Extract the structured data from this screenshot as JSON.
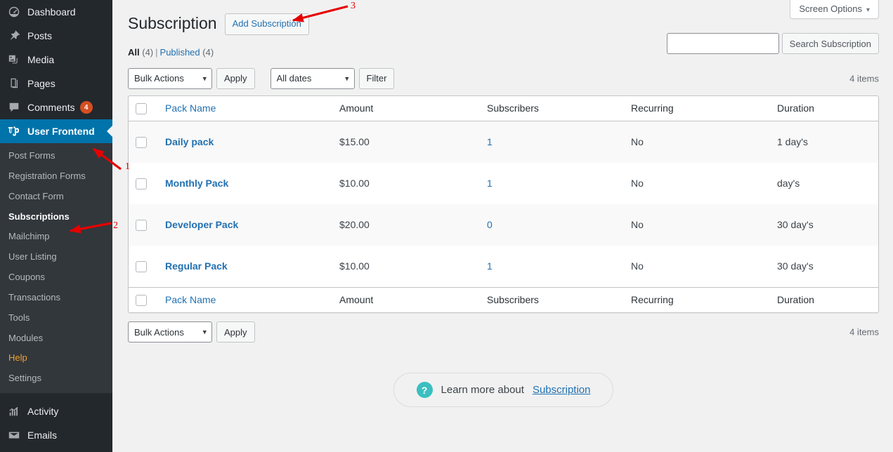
{
  "sidebar": {
    "top_items": [
      {
        "label": "Dashboard",
        "icon": "dashboard-icon",
        "badge": null,
        "current": false
      },
      {
        "label": "Posts",
        "icon": "pin-icon",
        "badge": null,
        "current": false
      },
      {
        "label": "Media",
        "icon": "media-icon",
        "badge": null,
        "current": false
      },
      {
        "label": "Pages",
        "icon": "pages-icon",
        "badge": null,
        "current": false
      },
      {
        "label": "Comments",
        "icon": "comment-icon",
        "badge": "4",
        "current": false
      },
      {
        "label": "User Frontend",
        "icon": "wpuf-logo-icon",
        "badge": null,
        "current": true
      }
    ],
    "submenu": [
      {
        "label": "Post Forms",
        "state": "normal"
      },
      {
        "label": "Registration Forms",
        "state": "normal"
      },
      {
        "label": "Contact Form",
        "state": "normal"
      },
      {
        "label": "Subscriptions",
        "state": "current"
      },
      {
        "label": "Mailchimp",
        "state": "normal"
      },
      {
        "label": "User Listing",
        "state": "normal"
      },
      {
        "label": "Coupons",
        "state": "normal"
      },
      {
        "label": "Transactions",
        "state": "normal"
      },
      {
        "label": "Tools",
        "state": "normal"
      },
      {
        "label": "Modules",
        "state": "normal"
      },
      {
        "label": "Help",
        "state": "help"
      },
      {
        "label": "Settings",
        "state": "normal"
      }
    ],
    "bottom_items": [
      {
        "label": "Activity",
        "icon": "activity-icon"
      },
      {
        "label": "Emails",
        "icon": "envelope-icon"
      }
    ]
  },
  "screen_meta": {
    "screen_options_label": "Screen Options",
    "caret": "▾"
  },
  "header": {
    "title": "Subscription",
    "add_button_label": "Add Subscription"
  },
  "search": {
    "value": "",
    "placeholder": "",
    "submit_label": "Search Subscription"
  },
  "views": {
    "all_label": "All",
    "all_count": "(4)",
    "divider": "|",
    "published_label": "Published",
    "published_count": "(4)"
  },
  "tablenav_top": {
    "bulk_actions_value": "Bulk Actions",
    "bulk_actions_options": [
      "Bulk Actions"
    ],
    "apply_label": "Apply",
    "dates_value": "All dates",
    "dates_options": [
      "All dates"
    ],
    "filter_label": "Filter",
    "items_count": "4 items"
  },
  "tablenav_bottom": {
    "bulk_actions_value": "Bulk Actions",
    "bulk_actions_options": [
      "Bulk Actions"
    ],
    "apply_label": "Apply",
    "items_count": "4 items"
  },
  "table": {
    "columns": [
      "Pack Name",
      "Amount",
      "Subscribers",
      "Recurring",
      "Duration"
    ],
    "rows": [
      {
        "name": "Daily pack",
        "amount": "$15.00",
        "subscribers": "1",
        "recurring": "No",
        "duration": "1 day's"
      },
      {
        "name": "Monthly Pack",
        "amount": "$10.00",
        "subscribers": "1",
        "recurring": "No",
        "duration": "day's"
      },
      {
        "name": "Developer Pack",
        "amount": "$20.00",
        "subscribers": "0",
        "recurring": "No",
        "duration": "30 day's"
      },
      {
        "name": "Regular Pack",
        "amount": "$10.00",
        "subscribers": "1",
        "recurring": "No",
        "duration": "30 day's"
      }
    ]
  },
  "learn_more": {
    "text": "Learn more about",
    "link_label": "Subscription",
    "icon": "question-mark-icon",
    "icon_color": "#3bbfc0"
  },
  "annotations": [
    {
      "number": "1"
    },
    {
      "number": "2"
    },
    {
      "number": "3"
    }
  ],
  "colors": {
    "sidebar_bg": "#23282d",
    "submenu_bg": "#32373c",
    "current_blue": "#0073aa",
    "link_blue": "#2271b1",
    "badge_orange": "#d54e21",
    "help_orange": "#f0a030",
    "annotation_red": "#e60000"
  }
}
